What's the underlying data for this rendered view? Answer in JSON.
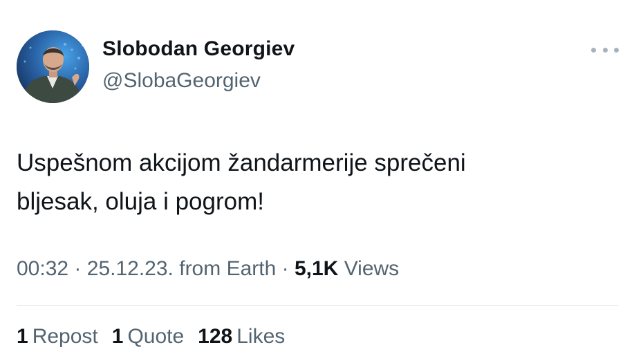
{
  "author": {
    "name": "Slobodan Georgiev",
    "handle": "@SlobaGeorgiev"
  },
  "more_icon": "ellipsis-horizontal-icon",
  "tweet": {
    "lines": [
      "Uspešnom akcijom žandarmerije sprečeni",
      "bljesak, oluja i pogrom!"
    ]
  },
  "meta": {
    "time": "00:32",
    "sep1": "·",
    "date": "25.12.23.",
    "source": "from Earth",
    "sep2": "·",
    "views_count": "5,1K",
    "views_label": "Views"
  },
  "stats": {
    "reposts_count": "1",
    "reposts_label": "Repost",
    "quotes_count": "1",
    "quotes_label": "Quote",
    "likes_count": "128",
    "likes_label": "Likes"
  },
  "colors": {
    "text": "#0f1419",
    "secondary": "#536471",
    "divider": "#e2e6ea"
  }
}
